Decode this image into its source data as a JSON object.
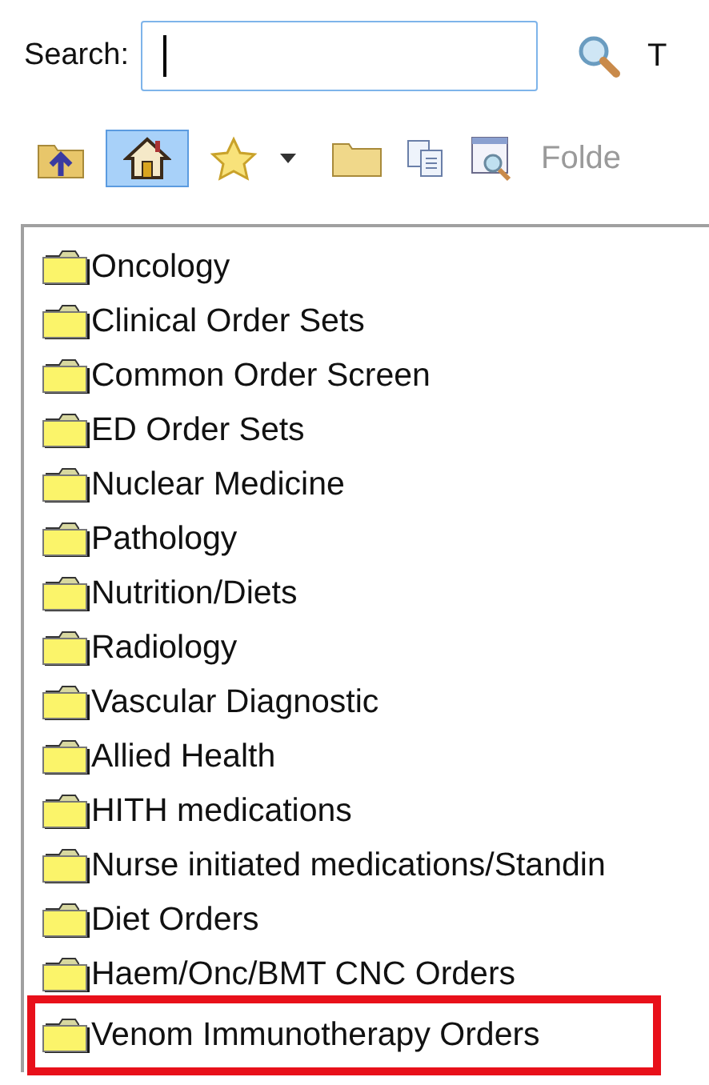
{
  "search": {
    "label": "Search:",
    "focused": true
  },
  "search_panel_cut_text": "T",
  "toolbar": {
    "buttons": [
      {
        "kind": "up",
        "selected": false
      },
      {
        "kind": "home",
        "selected": true
      },
      {
        "kind": "favorite",
        "selected": false
      },
      {
        "kind": "dropdown",
        "selected": false
      },
      {
        "kind": "folder",
        "selected": false
      },
      {
        "kind": "copy",
        "selected": false
      },
      {
        "kind": "preview",
        "selected": false
      }
    ],
    "cut_label": "Folde"
  },
  "folders": [
    {
      "name": "Oncology",
      "highlighted": false
    },
    {
      "name": "Clinical Order Sets",
      "highlighted": false
    },
    {
      "name": "Common Order Screen",
      "highlighted": false
    },
    {
      "name": "ED Order Sets",
      "highlighted": false
    },
    {
      "name": "Nuclear Medicine",
      "highlighted": false
    },
    {
      "name": "Pathology",
      "highlighted": false
    },
    {
      "name": "Nutrition/Diets",
      "highlighted": false
    },
    {
      "name": "Radiology",
      "highlighted": false
    },
    {
      "name": "Vascular Diagnostic",
      "highlighted": false
    },
    {
      "name": "Allied Health",
      "highlighted": false
    },
    {
      "name": "HITH medications",
      "highlighted": false
    },
    {
      "name": "Nurse initiated medications/Standin",
      "highlighted": false
    },
    {
      "name": "Diet Orders",
      "highlighted": false
    },
    {
      "name": "Haem/Onc/BMT CNC Orders",
      "highlighted": false
    },
    {
      "name": "Venom Immunotherapy Orders",
      "highlighted": true
    }
  ]
}
